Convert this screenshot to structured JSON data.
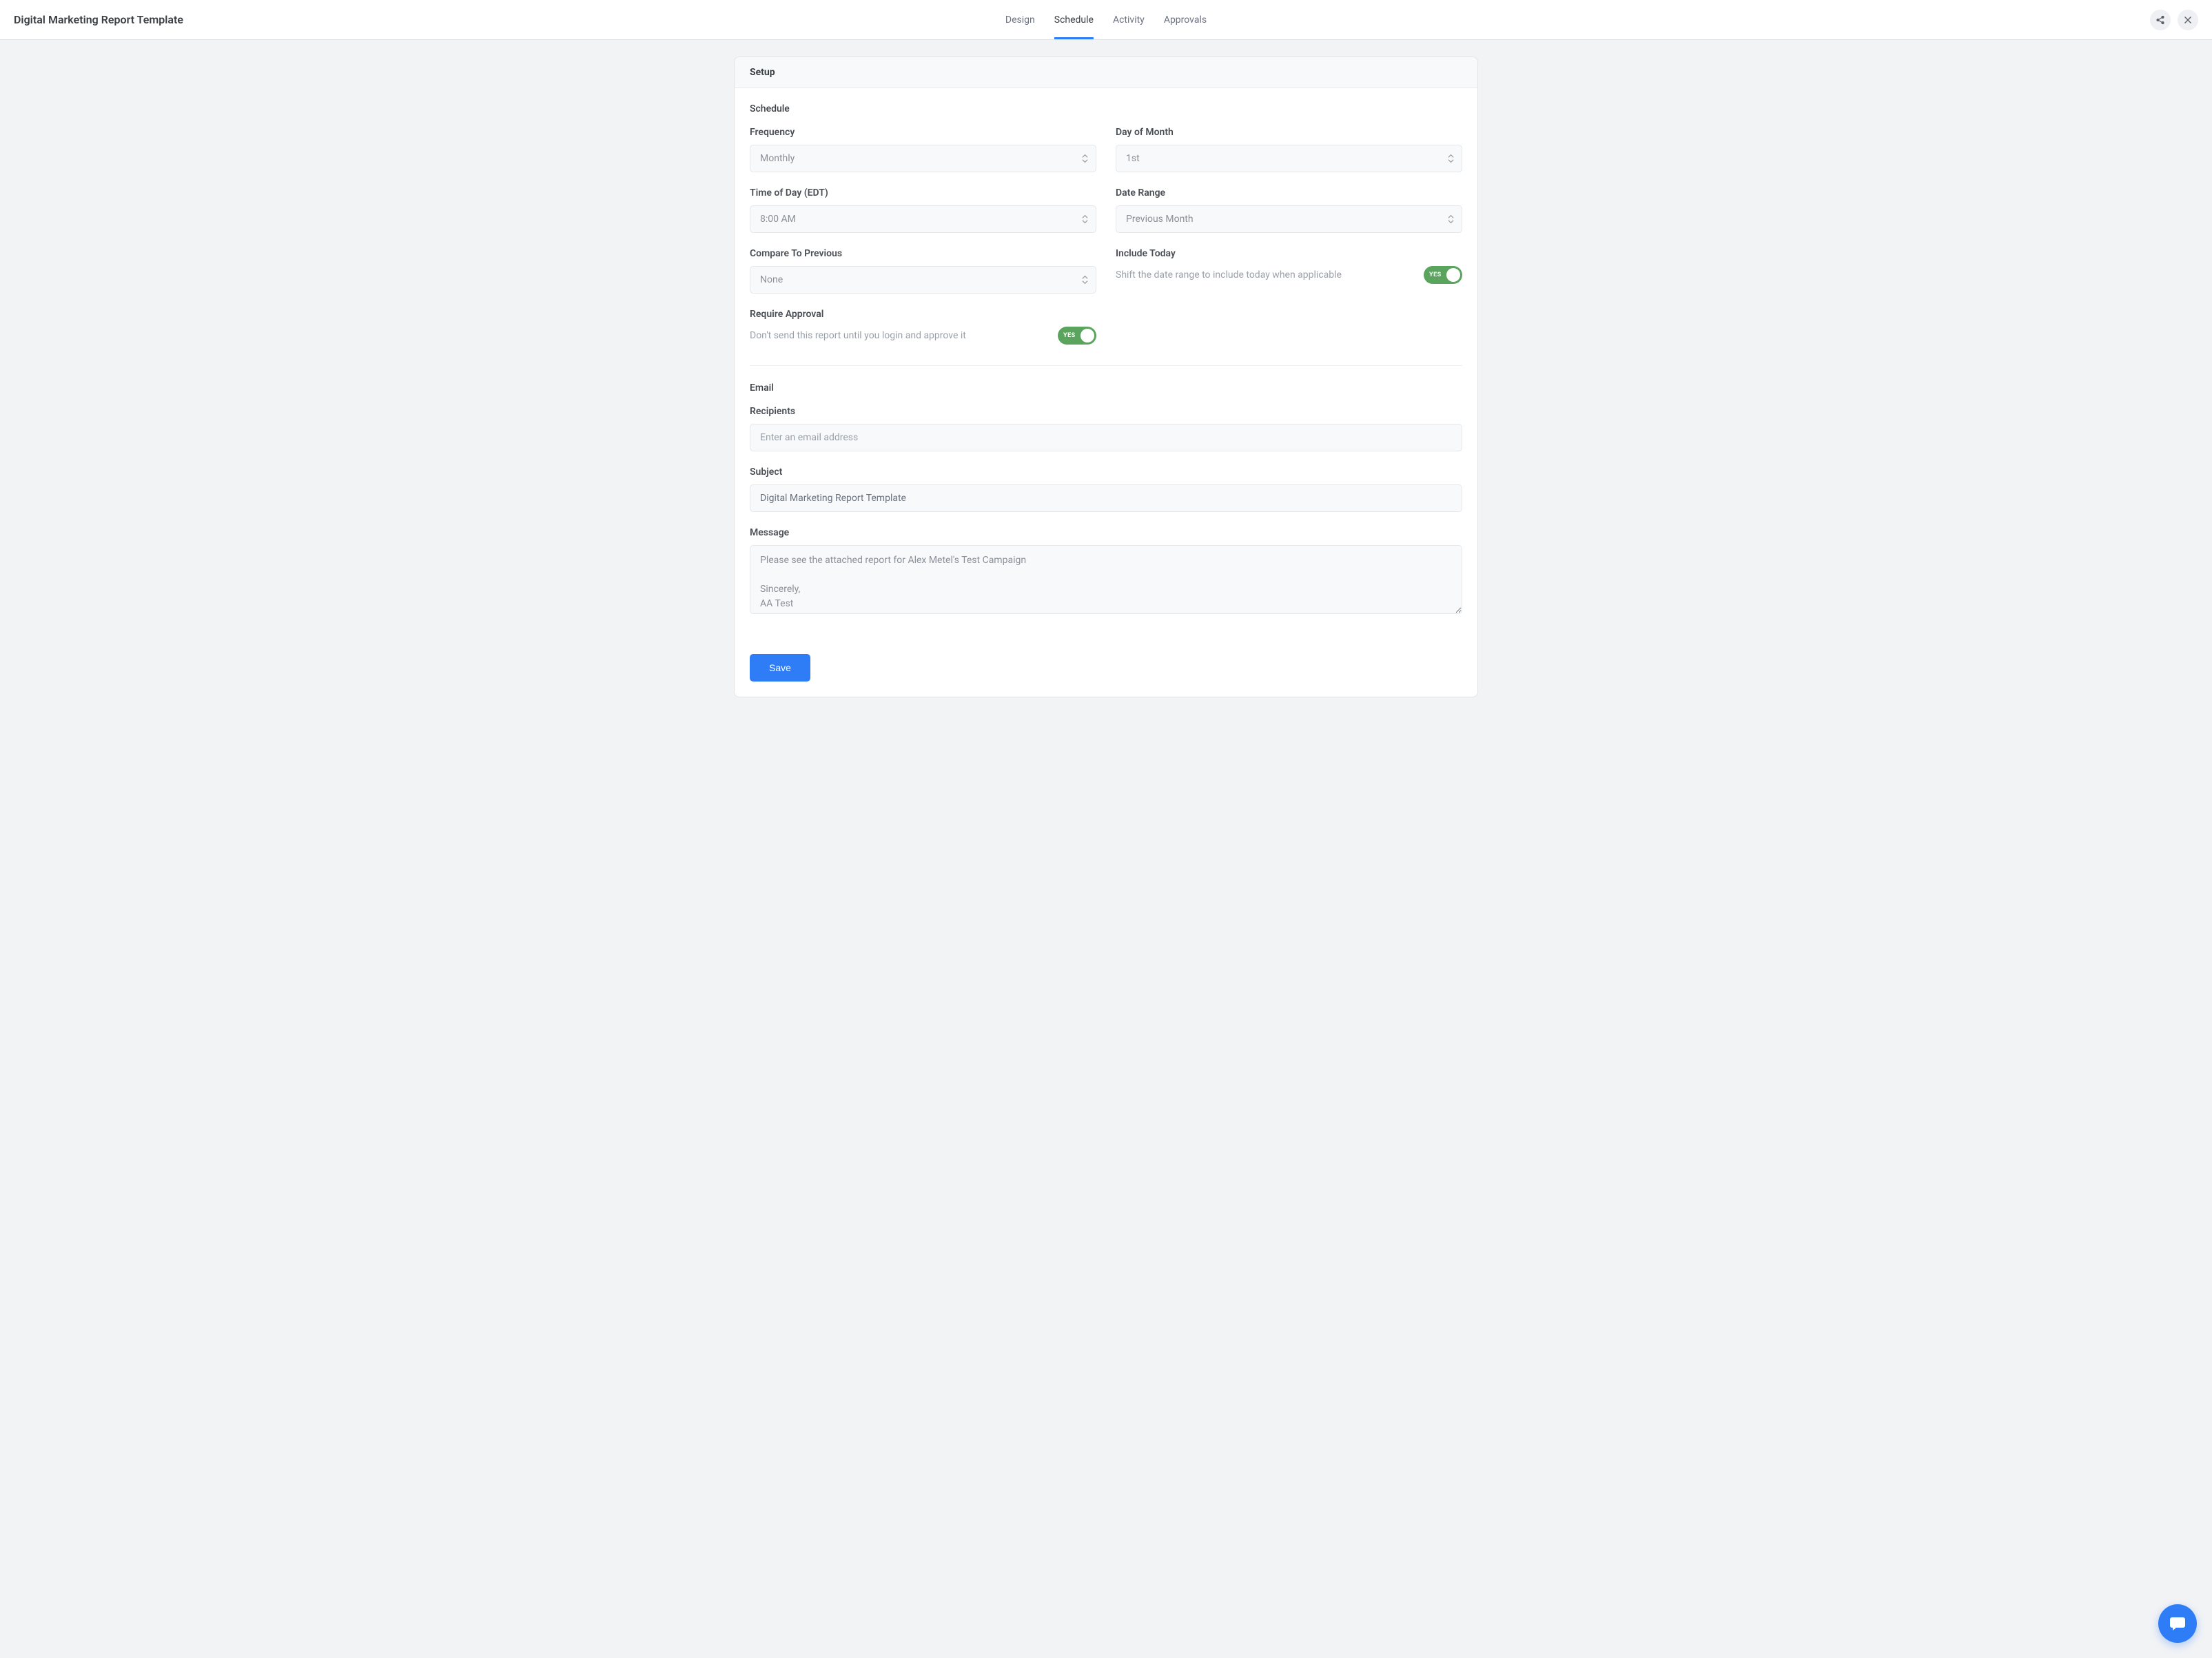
{
  "header": {
    "title": "Digital Marketing Report Template",
    "tabs": [
      "Design",
      "Schedule",
      "Activity",
      "Approvals"
    ],
    "active_tab": "Schedule"
  },
  "card": {
    "title": "Setup"
  },
  "schedule": {
    "section_title": "Schedule",
    "frequency": {
      "label": "Frequency",
      "value": "Monthly"
    },
    "day_of_month": {
      "label": "Day of Month",
      "value": "1st"
    },
    "time_of_day": {
      "label": "Time of Day (EDT)",
      "value": "8:00 AM"
    },
    "date_range": {
      "label": "Date Range",
      "value": "Previous Month"
    },
    "compare": {
      "label": "Compare To Previous",
      "value": "None"
    },
    "include_today": {
      "label": "Include Today",
      "description": "Shift the date range to include today when applicable",
      "toggle_text": "YES"
    },
    "require_approval": {
      "label": "Require Approval",
      "description": "Don't send this report until you login and approve it",
      "toggle_text": "YES"
    }
  },
  "email": {
    "section_title": "Email",
    "recipients": {
      "label": "Recipients",
      "placeholder": "Enter an email address"
    },
    "subject": {
      "label": "Subject",
      "value": "Digital Marketing Report Template"
    },
    "message": {
      "label": "Message",
      "value": "Please see the attached report for Alex Metel's Test Campaign\n\nSincerely,\nAA Test"
    }
  },
  "footer": {
    "save_label": "Save"
  }
}
